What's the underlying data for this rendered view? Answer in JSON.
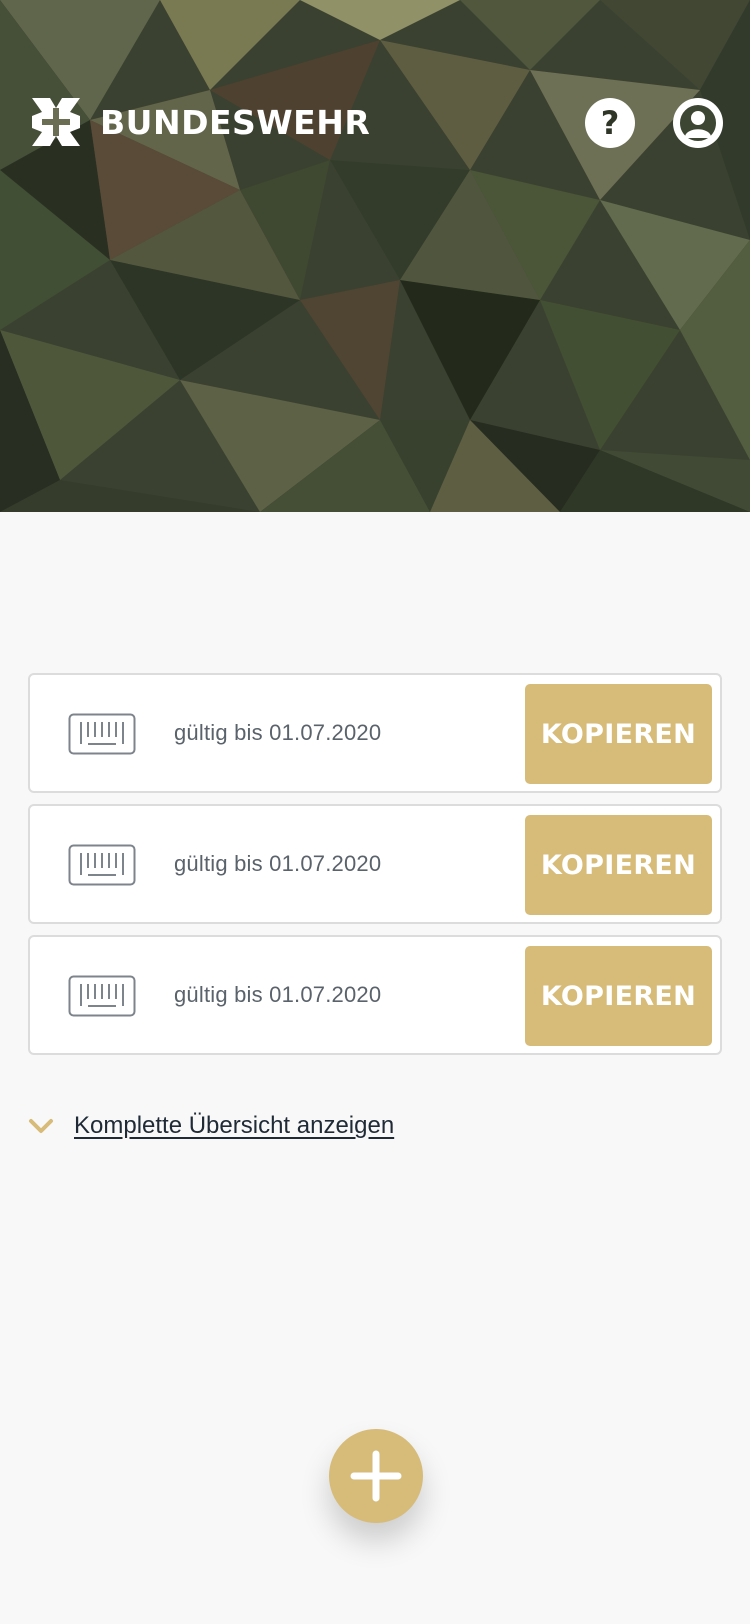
{
  "header": {
    "brand_name": "BUNDESWEHR",
    "help_icon": "help-circle-icon",
    "help_glyph": "?",
    "profile_icon": "user-circle-icon"
  },
  "codes": [
    {
      "icon": "barcode-icon",
      "valid_text": "gültig bis 01.07.2020",
      "button_label": "KOPIEREN"
    },
    {
      "icon": "barcode-icon",
      "valid_text": "gültig bis 01.07.2020",
      "button_label": "KOPIEREN"
    },
    {
      "icon": "barcode-icon",
      "valid_text": "gültig bis 01.07.2020",
      "button_label": "KOPIEREN"
    }
  ],
  "overview": {
    "icon": "chevron-down-icon",
    "link_text": "Komplette Übersicht anzeigen"
  },
  "fab": {
    "icon": "plus-icon"
  },
  "colors": {
    "accent": "#d7bb79",
    "background": "#f8f8f8",
    "card_border": "#dcdcdc",
    "text_muted": "#5a626b",
    "link_text": "#1f2a36"
  }
}
